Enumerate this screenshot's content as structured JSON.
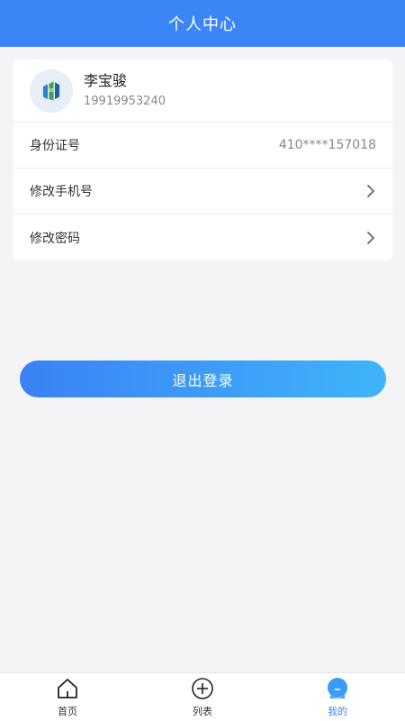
{
  "header": {
    "title": "个人中心"
  },
  "profile": {
    "name": "李宝骏",
    "phone": "19919953240"
  },
  "rows": [
    {
      "label": "身份证号",
      "value": "410****157018"
    },
    {
      "label": "修改手机号"
    },
    {
      "label": "修改密码"
    }
  ],
  "logout_label": "退出登录",
  "tabbar": {
    "items": [
      {
        "label": "首页",
        "icon": "home-icon"
      },
      {
        "label": "列表",
        "icon": "plus-circle-icon"
      },
      {
        "label": "我的",
        "icon": "user-icon",
        "active": true
      }
    ]
  },
  "colors": {
    "primary": "#3a86f7",
    "gradient_end": "#3fb4fa",
    "background": "#f4f4f6"
  }
}
